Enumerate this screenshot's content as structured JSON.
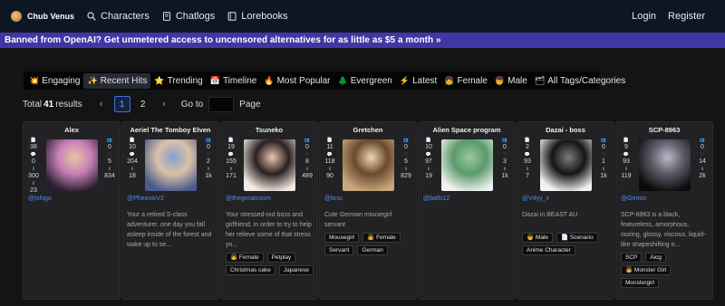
{
  "brand": {
    "name": "Chub Venus"
  },
  "nav": {
    "links": [
      {
        "label": "Characters",
        "icon": "search-icon"
      },
      {
        "label": "Chatlogs",
        "icon": "document-icon"
      },
      {
        "label": "Lorebooks",
        "icon": "book-icon"
      }
    ],
    "login": "Login",
    "register": "Register"
  },
  "banner": {
    "text": "Banned from OpenAI? Get unmetered access to uncensored alternatives for as little as $5 a month »"
  },
  "tabs": [
    {
      "label": "Engaging",
      "icon": "💥",
      "active": false
    },
    {
      "label": "Recent Hits",
      "icon": "✨",
      "active": true
    },
    {
      "label": "Trending",
      "icon": "⭐",
      "active": false
    },
    {
      "label": "Timeline",
      "icon": "📅",
      "active": false
    },
    {
      "label": "Most Popular",
      "icon": "🔥",
      "active": false
    },
    {
      "label": "Evergreen",
      "icon": "🌲",
      "active": false
    },
    {
      "label": "Latest",
      "icon": "⚡",
      "active": false
    },
    {
      "label": "Female",
      "icon": "👧",
      "active": false
    },
    {
      "label": "Male",
      "icon": "👦",
      "active": false
    },
    {
      "label": "All Tags/Categories",
      "icon": "🗂",
      "active": false
    }
  ],
  "results": {
    "prefix": "Total",
    "count": "41",
    "suffix": "results",
    "pages": [
      "1",
      "2"
    ],
    "current_page": "1",
    "goto_label": "Go to",
    "page_label": "Page"
  },
  "colors": {
    "accent": "#4f8df0",
    "banner": "#4136a6",
    "nav_bg": "#0e1624",
    "card_bg": "#222224"
  },
  "cards": [
    {
      "title": "Alex",
      "left_stats": [
        "38",
        "0",
        "300",
        "23"
      ],
      "right_stats": [
        "0",
        "5",
        "834"
      ],
      "user": "@Ishigo",
      "description": "",
      "tags": [],
      "image_colors": [
        "#2a1f2e",
        "#c77fb8",
        "#e8c6a0"
      ]
    },
    {
      "title": "Aeriel The Tomboy Elven",
      "left_stats": [
        "10",
        "204",
        "18"
      ],
      "right_stats": [
        "0",
        "2",
        "1k"
      ],
      "user": "@PheonixV2",
      "description": "Your a retired S-class adventurer, one day you fall asleep inside of the forest and wake up to se...",
      "tags": [],
      "image_colors": [
        "#4a5a8a",
        "#d9c2a8",
        "#8a9fcf"
      ]
    },
    {
      "title": "Tsuneko",
      "left_stats": [
        "19",
        "155",
        "171"
      ],
      "right_stats": [
        "0",
        "8",
        "489"
      ],
      "user": "@thegreatcoom",
      "description": "Your stressed-out boss and girlfriend, in order to try to help her relieve some of that stress yo...",
      "tags": [
        "👧 Female",
        "Petplay",
        "Christmas cake",
        "Japanese"
      ],
      "image_colors": [
        "#f3ece4",
        "#2b2020",
        "#e8c8b4"
      ]
    },
    {
      "title": "Gretchen",
      "left_stats": [
        "11",
        "118",
        "90"
      ],
      "right_stats": [
        "0",
        "5",
        "829"
      ],
      "user": "@brsc",
      "description": "Cute German mousegirl servant",
      "tags": [
        "Mousegirl",
        "👧 Female",
        "Servant",
        "German"
      ],
      "image_colors": [
        "#caa77c",
        "#6a4a30",
        "#f0d8b0"
      ]
    },
    {
      "title": "Alien Space program",
      "left_stats": [
        "10",
        "97",
        "19"
      ],
      "right_stats": [
        "0",
        "3",
        "1k"
      ],
      "user": "@balls12",
      "description": "",
      "tags": [],
      "image_colors": [
        "#eef1ef",
        "#5a9a6a",
        "#9ac8a0"
      ]
    },
    {
      "title": "Dazai - boss",
      "left_stats": [
        "2",
        "93",
        "7"
      ],
      "right_stats": [
        "0",
        "1",
        "1k"
      ],
      "user": "@V4yy_x",
      "description": "Dazai in BEAST AU",
      "tags": [
        "👦 Male",
        "📄 Scenario",
        "Anime Character"
      ],
      "image_colors": [
        "#f2f2f2",
        "#151515",
        "#7a7a7a"
      ]
    },
    {
      "title": "SCP-8963",
      "left_stats": [
        "9",
        "93",
        "119"
      ],
      "right_stats": [
        "0",
        "14",
        "2k"
      ],
      "user": "@Genoo",
      "description": "SCP-8963 is a black, featureless, amorphous, oozing, glossy, viscous, liquid-like shapeshifting o...",
      "tags": [
        "SCP",
        "Aicg",
        "👧 Monster Girl",
        "Monstergirl"
      ],
      "image_colors": [
        "#0a0a0a",
        "#5a5a66",
        "#b8b8c8"
      ]
    }
  ]
}
